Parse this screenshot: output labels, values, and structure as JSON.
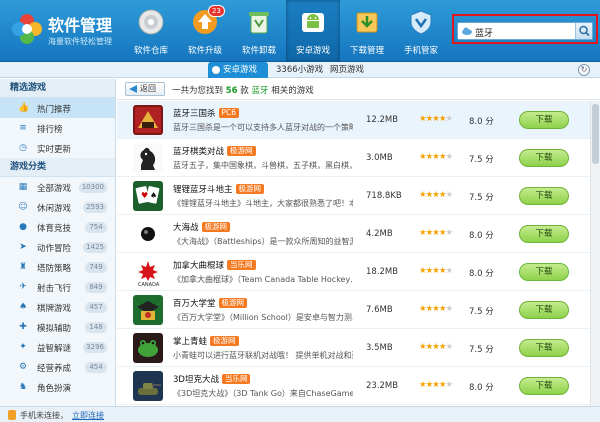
{
  "app": {
    "title": "软件管理",
    "subtitle": "海量软件轻松管理"
  },
  "nav": [
    {
      "label": "软件仓库",
      "icon": "disc-icon"
    },
    {
      "label": "软件升级",
      "icon": "upgrade-icon",
      "badge": "23"
    },
    {
      "label": "软件卸载",
      "icon": "recycle-bin-icon"
    },
    {
      "label": "安卓游戏",
      "icon": "android-icon",
      "active": true
    },
    {
      "label": "下载管理",
      "icon": "download-box-icon"
    },
    {
      "label": "手机管家",
      "icon": "shield-phone-icon"
    }
  ],
  "search": {
    "value": "蓝牙"
  },
  "tabs": {
    "active": "安卓游戏",
    "second": "3366小游戏",
    "third": "网页游戏"
  },
  "sidebar": {
    "featured_header": "精选游戏",
    "featured": [
      {
        "label": "热门推荐",
        "icon": "thumb-up-icon",
        "active": true
      },
      {
        "label": "排行榜",
        "icon": "ranking-icon"
      },
      {
        "label": "实时更新",
        "icon": "clock-icon"
      }
    ],
    "category_header": "游戏分类",
    "categories": [
      {
        "label": "全部游戏",
        "count": "10300",
        "icon": "grid-icon"
      },
      {
        "label": "休闲游戏",
        "count": "2593",
        "icon": "people-icon"
      },
      {
        "label": "体育竞技",
        "count": "754",
        "icon": "sports-icon"
      },
      {
        "label": "动作冒险",
        "count": "1425",
        "icon": "action-icon"
      },
      {
        "label": "塔防策略",
        "count": "749",
        "icon": "tower-icon"
      },
      {
        "label": "射击飞行",
        "count": "849",
        "icon": "plane-icon"
      },
      {
        "label": "棋牌游戏",
        "count": "457",
        "icon": "cards-icon"
      },
      {
        "label": "模拟辅助",
        "count": "148",
        "icon": "sim-icon"
      },
      {
        "label": "益智解谜",
        "count": "3296",
        "icon": "puzzle-icon"
      },
      {
        "label": "经营养成",
        "count": "454",
        "icon": "business-icon"
      },
      {
        "label": "角色扮演",
        "count": "",
        "icon": "role-icon"
      }
    ]
  },
  "results": {
    "back_label": "返回",
    "prefix": "一共为您找到",
    "count": "56",
    "middle": "款",
    "keyword": "蓝牙",
    "suffix": "相关的游戏"
  },
  "apps": [
    {
      "name": "蓝牙三国杀",
      "tag": "PC6",
      "desc": "蓝牙三国杀是一个可以支持多人蓝牙对战的一个策略…",
      "size": "12.2MB",
      "stars": 4,
      "rating": "8.0 分",
      "download": "下载",
      "icon": "sanguosha-icon"
    },
    {
      "name": "蓝牙棋类对战",
      "tag": "极游网",
      "desc": "蓝牙五子，集中国象棋，斗兽棋，五子棋，黑白棋，…",
      "size": "3.0MB",
      "stars": 4,
      "rating": "7.5 分",
      "download": "下载",
      "icon": "chess-icon"
    },
    {
      "name": "锂锂蓝牙斗地主",
      "tag": "极游网",
      "desc": "《锂锂蓝牙斗地主》斗地主，大家都很熟悉了吧！本…",
      "size": "718.8KB",
      "stars": 4,
      "rating": "7.5 分",
      "download": "下载",
      "icon": "cards-game-icon"
    },
    {
      "name": "大海战",
      "tag": "极游网",
      "desc": "《大海战》（Battleships）是一款众所周知的益智游…",
      "size": "4.2MB",
      "stars": 4,
      "rating": "8.0 分",
      "download": "下载",
      "icon": "battleship-icon"
    },
    {
      "name": "加拿大曲棍球",
      "tag": "当乐网",
      "desc": "《加拿大曲棍球》（Team Canada Table Hockey…",
      "size": "18.2MB",
      "stars": 4,
      "rating": "8.0 分",
      "download": "下载",
      "icon": "hockey-icon"
    },
    {
      "name": "百万大学堂",
      "tag": "极游网",
      "desc": "《百万大学堂》（Million School）是安卓与智力测…",
      "size": "7.6MB",
      "stars": 4,
      "rating": "7.5 分",
      "download": "下载",
      "icon": "school-icon"
    },
    {
      "name": "掌上青蛙",
      "tag": "极游网",
      "desc": "小青蛙可以进行蓝牙联机对战哦！ 提供单机对战和蓝牙…",
      "size": "3.5MB",
      "stars": 4,
      "rating": "7.5 分",
      "download": "下载",
      "icon": "frog-icon"
    },
    {
      "name": "3D坦克大战",
      "tag": "当乐网",
      "desc": "《3D坦克大战》（3D Tank Go）来自ChaseGames…",
      "size": "23.2MB",
      "stars": 4,
      "rating": "8.0 分",
      "download": "下载",
      "icon": "tank-icon"
    }
  ],
  "status": {
    "text": "手机未连接，",
    "link": "立即连接"
  },
  "colors": {
    "header": "#1e88cf",
    "tag": "#f47920",
    "download": "#8fd14b",
    "highlight": "#1a9a2a",
    "search_outline": "#e0161c"
  }
}
